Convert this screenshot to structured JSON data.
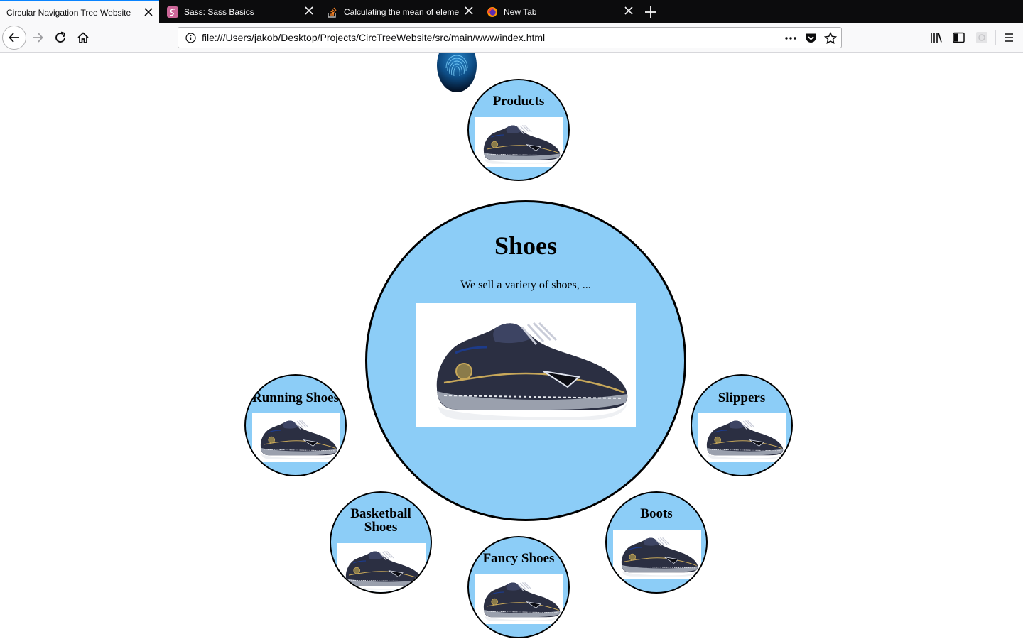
{
  "browser": {
    "tabs": [
      {
        "title": "Circular Navigation Tree Website",
        "active": true,
        "icon": "none"
      },
      {
        "title": "Sass: Sass Basics",
        "active": false,
        "icon": "sass-icon"
      },
      {
        "title": "Calculating the mean of elemen",
        "active": false,
        "icon": "stackoverflow-icon"
      },
      {
        "title": "New Tab",
        "active": false,
        "icon": "firefox-icon"
      }
    ],
    "url": "file:///Users/jakob/Desktop/Projects/CircTreeWebsite/src/main/www/index.html",
    "accent_color": "#0a84ff"
  },
  "page": {
    "main_node": {
      "title": "Shoes",
      "description": "We sell a variety of shoes, ..."
    },
    "parent_node": {
      "title": "Products"
    },
    "child_nodes": [
      {
        "title": "Running Shoes"
      },
      {
        "title": "Slippers"
      },
      {
        "title": "Basketball Shoes"
      },
      {
        "title": "Boots"
      },
      {
        "title": "Fancy Shoes"
      }
    ],
    "circle_color": "#8ccdf7"
  }
}
